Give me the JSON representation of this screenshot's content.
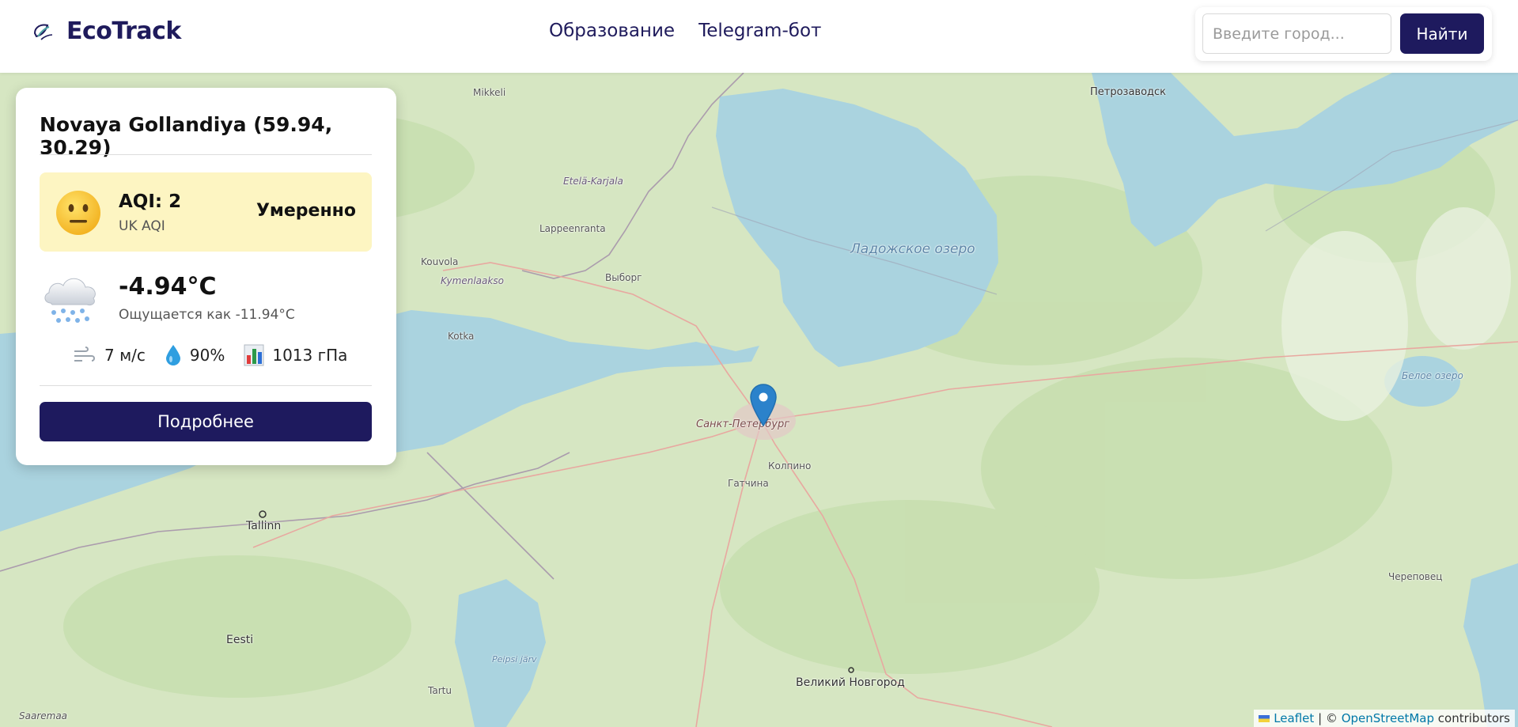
{
  "header": {
    "brand": "EcoTrack",
    "nav": [
      "Образование",
      "Telegram-бот"
    ],
    "search_placeholder": "Введите город...",
    "search_button": "Найти"
  },
  "card": {
    "title": "Novaya Gollandiya (59.94, 30.29)",
    "aqi": {
      "value_label": "AQI: 2",
      "scale": "UK AQI",
      "status": "Умеренно",
      "emoji": "neutral-face-icon",
      "color": "#fdf5c2"
    },
    "weather": {
      "icon": "snow-cloud-icon",
      "temperature": "-4.94°C",
      "feels_like": "Ощущается как -11.94°C",
      "wind": "7 м/с",
      "humidity": "90%",
      "pressure": "1013 гПа"
    },
    "details_button": "Подробнее"
  },
  "map": {
    "labels": {
      "petrozavodsk": "Петрозаводск",
      "mikkeli": "Mikkeli",
      "etela_karjala": "Etelä-Karjala",
      "lappeenranta": "Lappeenranta",
      "ladoga": "Ладожское озеро",
      "kouvola": "Kouvola",
      "kymenlaakso": "Kymenlaakso",
      "vyborg": "Выборг",
      "kotka": "Kotka",
      "spb": "Санкт-Петербург",
      "kolpino": "Колпино",
      "gatchina": "Гатчина",
      "tallinn": "Tallinn",
      "beloe": "Белое озеро",
      "cherepovets": "Череповец",
      "eesti": "Eesti",
      "tartu": "Tartu",
      "novgorod": "Великий Новгород",
      "saaremaa": "Saaremaa",
      "peipsi": "Peipsi järv"
    },
    "attribution": {
      "leaflet": "Leaflet",
      "separator": "| ©",
      "osm": "OpenStreetMap",
      "suffix": "contributors"
    }
  },
  "colors": {
    "brand": "#1e1a5e",
    "water": "#aad3df",
    "land": "#d9e8c4",
    "aqi_moderate": "#fdf5c2"
  }
}
